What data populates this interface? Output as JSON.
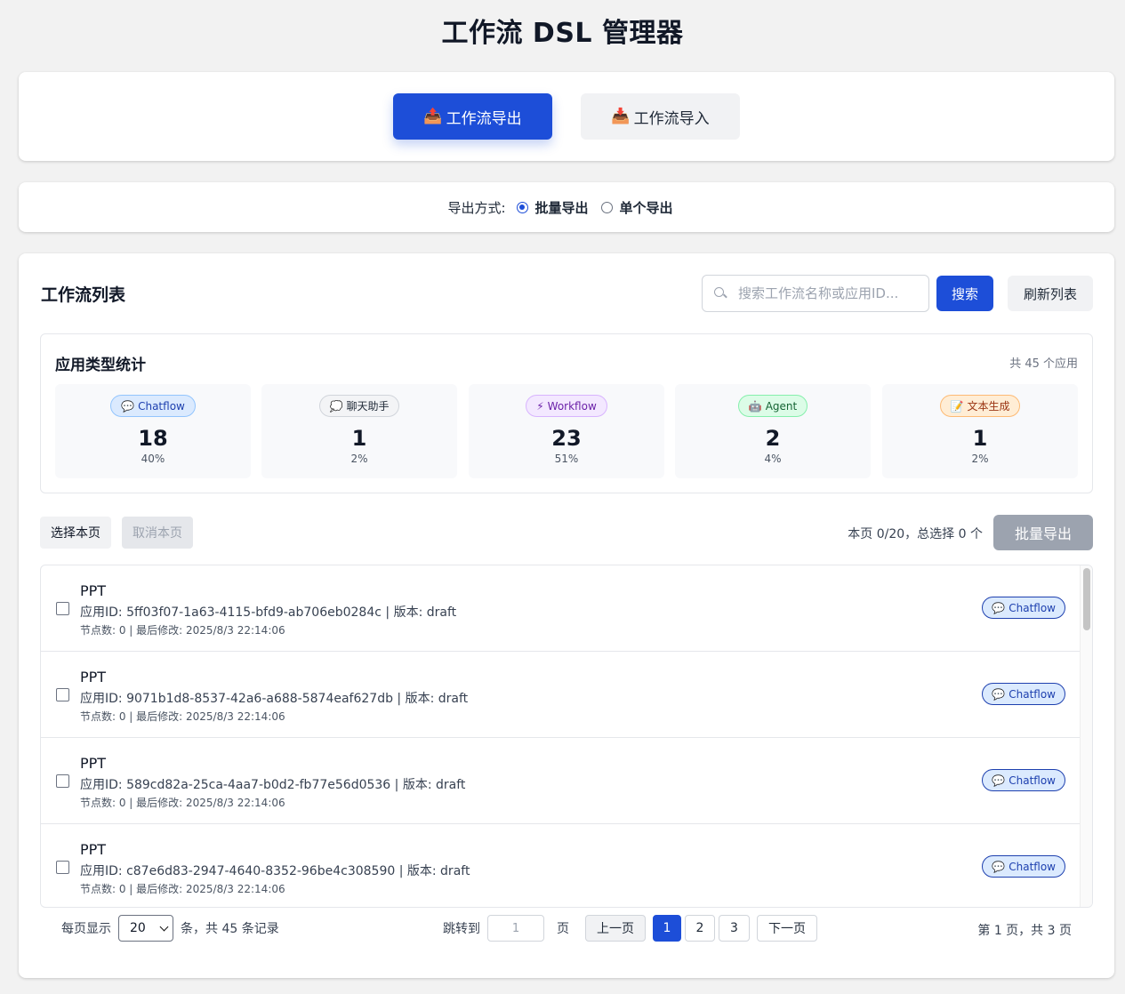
{
  "title": "工作流 DSL 管理器",
  "tabs": [
    {
      "icon": "📤",
      "label": "工作流导出"
    },
    {
      "icon": "📥",
      "label": "工作流导入"
    }
  ],
  "export_mode": {
    "label": "导出方式:",
    "options": [
      "批量导出",
      "单个导出"
    ],
    "selected": "批量导出"
  },
  "list_section": {
    "title": "工作流列表",
    "search_placeholder": "搜索工作流名称或应用ID...",
    "search_label": "搜索",
    "refresh_label": "刷新列表"
  },
  "stats": {
    "title": "应用类型统计",
    "total": "共 45 个应用",
    "items": [
      {
        "icon": "💬",
        "label": "Chatflow",
        "count": "18",
        "pct": "40%"
      },
      {
        "icon": "💭",
        "label": "聊天助手",
        "count": "1",
        "pct": "2%"
      },
      {
        "icon": "⚡",
        "label": "Workflow",
        "count": "23",
        "pct": "51%"
      },
      {
        "icon": "🤖",
        "label": "Agent",
        "count": "2",
        "pct": "4%"
      },
      {
        "icon": "📝",
        "label": "文本生成",
        "count": "1",
        "pct": "2%"
      }
    ]
  },
  "selection": {
    "select_page": "选择本页",
    "unselect_page": "取消本页",
    "info": "本页 0/20，总选择 0 个",
    "bulk_export": "批量导出"
  },
  "rows": [
    {
      "name": "PPT",
      "meta": "应用ID: 5ff03f07-1a63-4115-bfd9-ab706eb0284c | 版本: draft",
      "sub": "节点数: 0 | 最后修改: 2025/8/3 22:14:06",
      "badge_icon": "💬",
      "badge": "Chatflow"
    },
    {
      "name": "PPT",
      "meta": "应用ID: 9071b1d8-8537-42a6-a688-5874eaf627db | 版本: draft",
      "sub": "节点数: 0 | 最后修改: 2025/8/3 22:14:06",
      "badge_icon": "💬",
      "badge": "Chatflow"
    },
    {
      "name": "PPT",
      "meta": "应用ID: 589cd82a-25ca-4aa7-b0d2-fb77e56d0536 | 版本: draft",
      "sub": "节点数: 0 | 最后修改: 2025/8/3 22:14:06",
      "badge_icon": "💬",
      "badge": "Chatflow"
    },
    {
      "name": "PPT",
      "meta": "应用ID: c87e6d83-2947-4640-8352-96be4c308590 | 版本: draft",
      "sub": "节点数: 0 | 最后修改: 2025/8/3 22:14:06",
      "badge_icon": "💬",
      "badge": "Chatflow"
    }
  ],
  "pagination": {
    "per_page_label": "每页显示",
    "per_page": "20",
    "records": "条，共 45 条记录",
    "jump_label": "跳转到",
    "jump_placeholder": "1",
    "page_suffix": "页",
    "prev": "上一页",
    "pages": [
      "1",
      "2",
      "3"
    ],
    "current": "1",
    "next": "下一页",
    "summary": "第 1 页，共 3 页"
  },
  "colors": {
    "primary": "#1d4ed8",
    "disabled": "#9ca3af"
  }
}
